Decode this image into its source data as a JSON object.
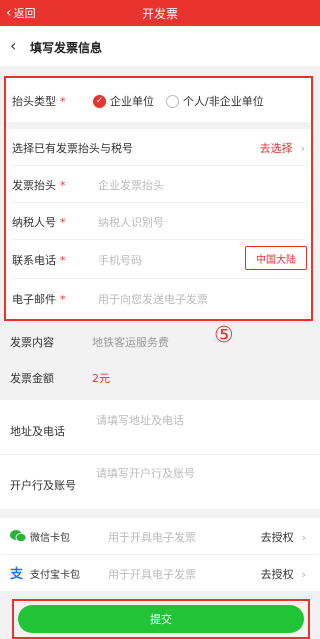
{
  "topbar": {
    "back": "返回",
    "title": "开发票"
  },
  "subhead": {
    "title": "填写发票信息"
  },
  "form": {
    "invoice_type": {
      "label": "抬头类型",
      "req": "*",
      "opt_company": "企业单位",
      "opt_personal": "个人/非企业单位",
      "selected": "企业单位"
    },
    "choose_existing": {
      "label": "选择已有发票抬头与税号",
      "link": "去选择"
    },
    "invoice_title": {
      "label": "发票抬头",
      "req": "*",
      "placeholder": "企业发票抬头"
    },
    "tax_id": {
      "label": "纳税人号",
      "req": "*",
      "placeholder": "纳税人识别号"
    },
    "phone": {
      "label": "联系电话",
      "req": "*",
      "placeholder": "手机号码",
      "region": "中国大陆"
    },
    "email": {
      "label": "电子邮件",
      "req": "*",
      "placeholder": "用于向您发送电子发票"
    }
  },
  "annotation": "⑤",
  "info": {
    "content": {
      "label": "发票内容",
      "value": "地铁客运服务费"
    },
    "amount": {
      "label": "发票金额",
      "value": "2元"
    }
  },
  "extra": {
    "address": {
      "label": "地址及电话",
      "placeholder": "请填写地址及电话"
    },
    "bank": {
      "label": "开户行及账号",
      "placeholder": "请填写开户行及账号"
    }
  },
  "cards": {
    "wechat": {
      "label": "微信卡包",
      "hint": "用于开具电子发票",
      "action": "去授权"
    },
    "alipay": {
      "label": "支付宝卡包",
      "hint": "用于开具电子发票",
      "action": "去授权"
    }
  },
  "submit": {
    "label": "提交"
  },
  "colors": {
    "accent": "#e8332f",
    "submit": "#22c437"
  }
}
